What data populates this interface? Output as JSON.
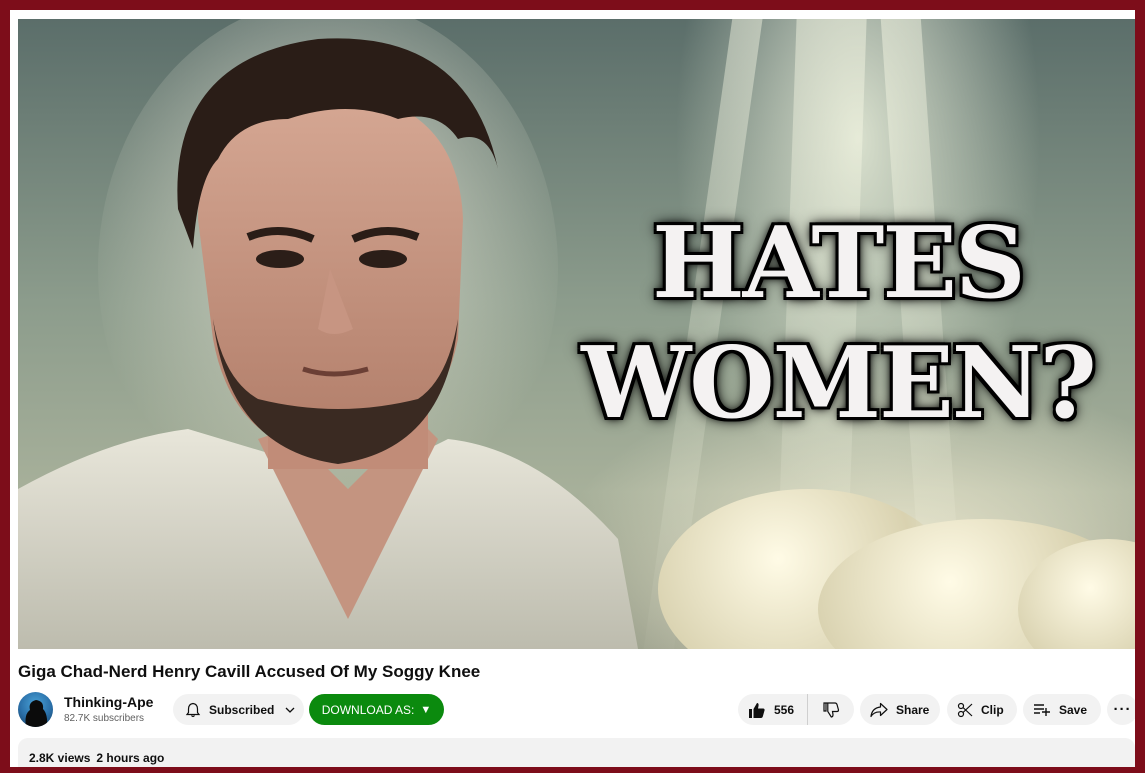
{
  "video": {
    "thumbnail_headline_line1": "HATES",
    "thumbnail_headline_line2": "WOMEN?",
    "title": "Giga Chad-Nerd Henry Cavill Accused Of My Soggy Knee"
  },
  "channel": {
    "name": "Thinking-Ape",
    "subscribers": "82.7K subscribers",
    "subscribed_label": "Subscribed"
  },
  "actions": {
    "download_label": "DOWNLOAD AS:",
    "download_arrow": "▼",
    "like_count": "556",
    "share_label": "Share",
    "clip_label": "Clip",
    "save_label": "Save",
    "more_label": "···"
  },
  "description": {
    "views": "2.8K views",
    "time": "2 hours ago"
  },
  "colors": {
    "frame_border": "#7d0d1a",
    "download_button": "#0b8a0e",
    "pill_background": "#f2f2f2"
  },
  "icons": [
    "bell-icon",
    "chevron-down-icon",
    "thumbs-up-icon",
    "thumbs-down-icon",
    "share-arrow-icon",
    "scissors-icon",
    "playlist-add-icon",
    "more-dots-icon"
  ]
}
